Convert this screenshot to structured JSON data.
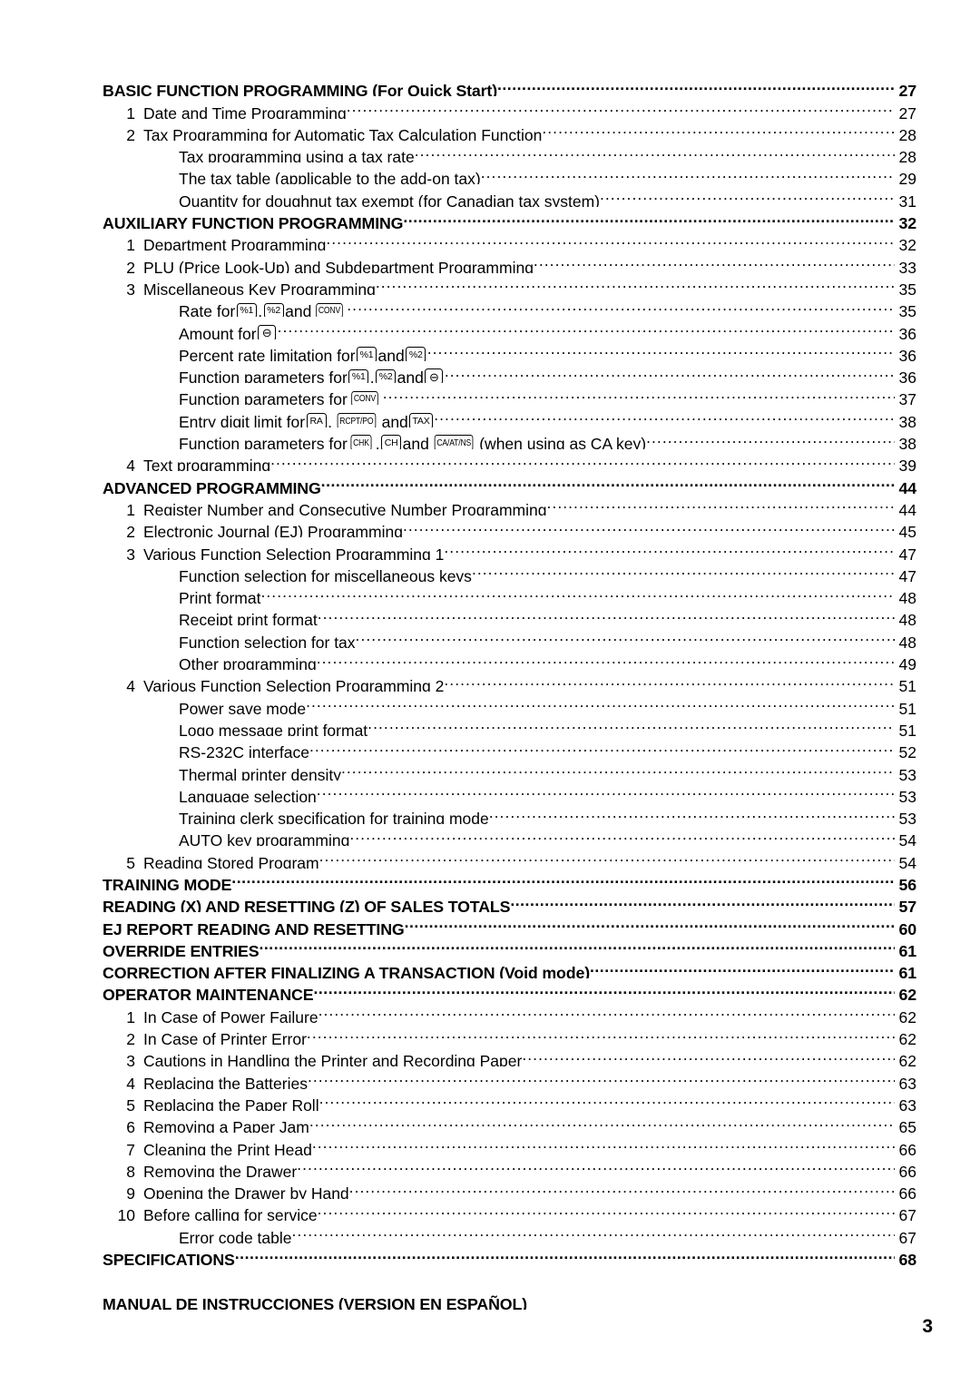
{
  "document": {
    "page_number": "3",
    "footer_heading": "MANUAL DE INSTRUCCIONES (VERSION EN ESPAÑOL)"
  },
  "toc": {
    "entries": [
      {
        "level": 1,
        "num": "",
        "text": "BASIC FUNCTION PROGRAMMING (For Quick Start)",
        "page": "27"
      },
      {
        "level": 2,
        "num": "1",
        "text": "Date and Time Programming",
        "page": "27"
      },
      {
        "level": 2,
        "num": "2",
        "text": "Tax Programming for Automatic Tax Calculation Function",
        "page": "28"
      },
      {
        "level": 3,
        "num": "",
        "text": "Tax programming using a tax rate",
        "page": "28"
      },
      {
        "level": 3,
        "num": "",
        "text": "The tax table (applicable to the add-on tax)",
        "page": "29"
      },
      {
        "level": 3,
        "num": "",
        "text": "Quantity for doughnut tax exempt (for Canadian tax system)",
        "page": "31"
      },
      {
        "level": 1,
        "num": "",
        "text": "AUXILIARY FUNCTION PROGRAMMING",
        "page": "32"
      },
      {
        "level": 2,
        "num": "1",
        "text": "Department Programming",
        "page": "32"
      },
      {
        "level": 2,
        "num": "2",
        "text": "PLU (Price Look-Up) and Subdepartment Programming",
        "page": "33"
      },
      {
        "level": 2,
        "num": "3",
        "text": "Miscellaneous Key Programming",
        "page": "35"
      },
      {
        "level": 3,
        "num": "",
        "text": "Rate for [%1], [%2] and [CONV]",
        "page": "35",
        "parts": [
          {
            "t": "text",
            "v": "Rate for "
          },
          {
            "t": "key",
            "v": "%1",
            "style": ""
          },
          {
            "t": "text",
            "v": ", "
          },
          {
            "t": "key",
            "v": "%2",
            "style": ""
          },
          {
            "t": "text",
            "v": " and "
          },
          {
            "t": "key",
            "v": "CONV",
            "style": "narrow"
          }
        ]
      },
      {
        "level": 3,
        "num": "",
        "text": "Amount for [-]",
        "page": "36",
        "parts": [
          {
            "t": "text",
            "v": "Amount for "
          },
          {
            "t": "key",
            "v": "⊖",
            "style": "minus"
          }
        ]
      },
      {
        "level": 3,
        "num": "",
        "text": "Percent rate limitation for [%1] and [%2]",
        "page": "36",
        "parts": [
          {
            "t": "text",
            "v": "Percent rate limitation for "
          },
          {
            "t": "key",
            "v": "%1",
            "style": ""
          },
          {
            "t": "text",
            "v": " and "
          },
          {
            "t": "key",
            "v": "%2",
            "style": ""
          }
        ]
      },
      {
        "level": 3,
        "num": "",
        "text": "Function parameters for [%1], [%2] and [-]",
        "page": "36",
        "parts": [
          {
            "t": "text",
            "v": "Function parameters for "
          },
          {
            "t": "key",
            "v": "%1",
            "style": ""
          },
          {
            "t": "text",
            "v": ", "
          },
          {
            "t": "key",
            "v": "%2",
            "style": ""
          },
          {
            "t": "text",
            "v": " and "
          },
          {
            "t": "key",
            "v": "⊖",
            "style": "minus"
          },
          {
            "t": "text",
            "v": " "
          }
        ]
      },
      {
        "level": 3,
        "num": "",
        "text": "Function parameters for [CONV]",
        "page": "37",
        "parts": [
          {
            "t": "text",
            "v": "Function parameters for "
          },
          {
            "t": "key",
            "v": "CONV",
            "style": "narrow"
          }
        ]
      },
      {
        "level": 3,
        "num": "",
        "text": "Entry digit limit for [RA], [RCPT/PO] and [TAX]",
        "page": "38",
        "parts": [
          {
            "t": "text",
            "v": "Entry digit limit for "
          },
          {
            "t": "key",
            "v": "RA",
            "style": ""
          },
          {
            "t": "text",
            "v": ", "
          },
          {
            "t": "key",
            "v": "RCPT/PO",
            "style": "narrow"
          },
          {
            "t": "text",
            "v": " and "
          },
          {
            "t": "key",
            "v": "TAX",
            "style": ""
          }
        ]
      },
      {
        "level": 3,
        "num": "",
        "text": "Function parameters for [CHK], [CH] and [CA/AT/NS] (when using as CA key)",
        "page": "38",
        "parts": [
          {
            "t": "text",
            "v": "Function parameters for "
          },
          {
            "t": "key",
            "v": "CHK",
            "style": "narrow"
          },
          {
            "t": "text",
            "v": ", "
          },
          {
            "t": "key",
            "v": "CH",
            "style": ""
          },
          {
            "t": "text",
            "v": " and "
          },
          {
            "t": "key",
            "v": "CA/AT/NS",
            "style": "narrow wide"
          },
          {
            "t": "text",
            "v": " (when using as CA key)"
          }
        ]
      },
      {
        "level": 2,
        "num": "4",
        "text": "Text programming",
        "page": "39"
      },
      {
        "level": 1,
        "num": "",
        "text": "ADVANCED PROGRAMMING",
        "page": "44"
      },
      {
        "level": 2,
        "num": "1",
        "text": "Register Number and Consecutive Number Programming",
        "page": "44"
      },
      {
        "level": 2,
        "num": "2",
        "text": "Electronic Journal (EJ) Programming",
        "page": "45"
      },
      {
        "level": 2,
        "num": "3",
        "text": "Various Function Selection Programming 1",
        "page": "47"
      },
      {
        "level": 3,
        "num": "",
        "text": "Function selection for miscellaneous keys",
        "page": "47"
      },
      {
        "level": 3,
        "num": "",
        "text": "Print format",
        "page": "48"
      },
      {
        "level": 3,
        "num": "",
        "text": "Receipt print format",
        "page": "48"
      },
      {
        "level": 3,
        "num": "",
        "text": "Function selection for tax",
        "page": "48"
      },
      {
        "level": 3,
        "num": "",
        "text": "Other programming",
        "page": "49"
      },
      {
        "level": 2,
        "num": "4",
        "text": "Various Function Selection Programming 2",
        "page": "51"
      },
      {
        "level": 3,
        "num": "",
        "text": "Power save mode",
        "page": "51"
      },
      {
        "level": 3,
        "num": "",
        "text": "Logo message print format",
        "page": "51"
      },
      {
        "level": 3,
        "num": "",
        "text": "RS-232C interface",
        "page": "52"
      },
      {
        "level": 3,
        "num": "",
        "text": "Thermal printer density",
        "page": "53"
      },
      {
        "level": 3,
        "num": "",
        "text": "Language selection",
        "page": "53"
      },
      {
        "level": 3,
        "num": "",
        "text": "Training clerk specification for training mode",
        "page": "53"
      },
      {
        "level": 3,
        "num": "",
        "text": "AUTO key programming",
        "page": "54"
      },
      {
        "level": 2,
        "num": "5",
        "text": "Reading Stored Program",
        "page": "54"
      },
      {
        "level": 1,
        "num": "",
        "text": "TRAINING MODE",
        "page": "56"
      },
      {
        "level": 1,
        "num": "",
        "text": "READING (X) AND RESETTING (Z) OF SALES TOTALS",
        "page": "57"
      },
      {
        "level": 1,
        "num": "",
        "text": "EJ REPORT READING AND RESETTING",
        "page": "60"
      },
      {
        "level": 1,
        "num": "",
        "text": "OVERRIDE ENTRIES",
        "page": "61"
      },
      {
        "level": 1,
        "num": "",
        "text": "CORRECTION AFTER FINALIZING A TRANSACTION (Void mode)",
        "page": "61"
      },
      {
        "level": 1,
        "num": "",
        "text": "OPERATOR MAINTENANCE",
        "page": "62"
      },
      {
        "level": 2,
        "num": "1",
        "text": "In Case of Power Failure",
        "page": "62"
      },
      {
        "level": 2,
        "num": "2",
        "text": "In Case of Printer Error",
        "page": "62"
      },
      {
        "level": 2,
        "num": "3",
        "text": "Cautions in Handling the Printer and Recording Paper",
        "page": "62"
      },
      {
        "level": 2,
        "num": "4",
        "text": "Replacing the Batteries",
        "page": "63"
      },
      {
        "level": 2,
        "num": "5",
        "text": "Replacing the Paper Roll",
        "page": "63"
      },
      {
        "level": 2,
        "num": "6",
        "text": "Removing a Paper Jam",
        "page": "65"
      },
      {
        "level": 2,
        "num": "7",
        "text": "Cleaning the Print Head",
        "page": "66"
      },
      {
        "level": 2,
        "num": "8",
        "text": "Removing the Drawer",
        "page": "66"
      },
      {
        "level": 2,
        "num": "9",
        "text": "Opening the Drawer by Hand",
        "page": "66"
      },
      {
        "level": 2,
        "num": "10",
        "text": "Before calling for service",
        "page": "67"
      },
      {
        "level": 3,
        "num": "",
        "text": "Error code table",
        "page": "67"
      },
      {
        "level": 1,
        "num": "",
        "text": "SPECIFICATIONS",
        "page": "68"
      },
      {
        "level": 0,
        "num": "",
        "text": "",
        "page": ""
      },
      {
        "level": 1,
        "num": "",
        "text": "MANUAL DE INSTRUCCIONES (VERSION EN ESPAÑOL)",
        "page": "",
        "noleader": true
      }
    ]
  }
}
